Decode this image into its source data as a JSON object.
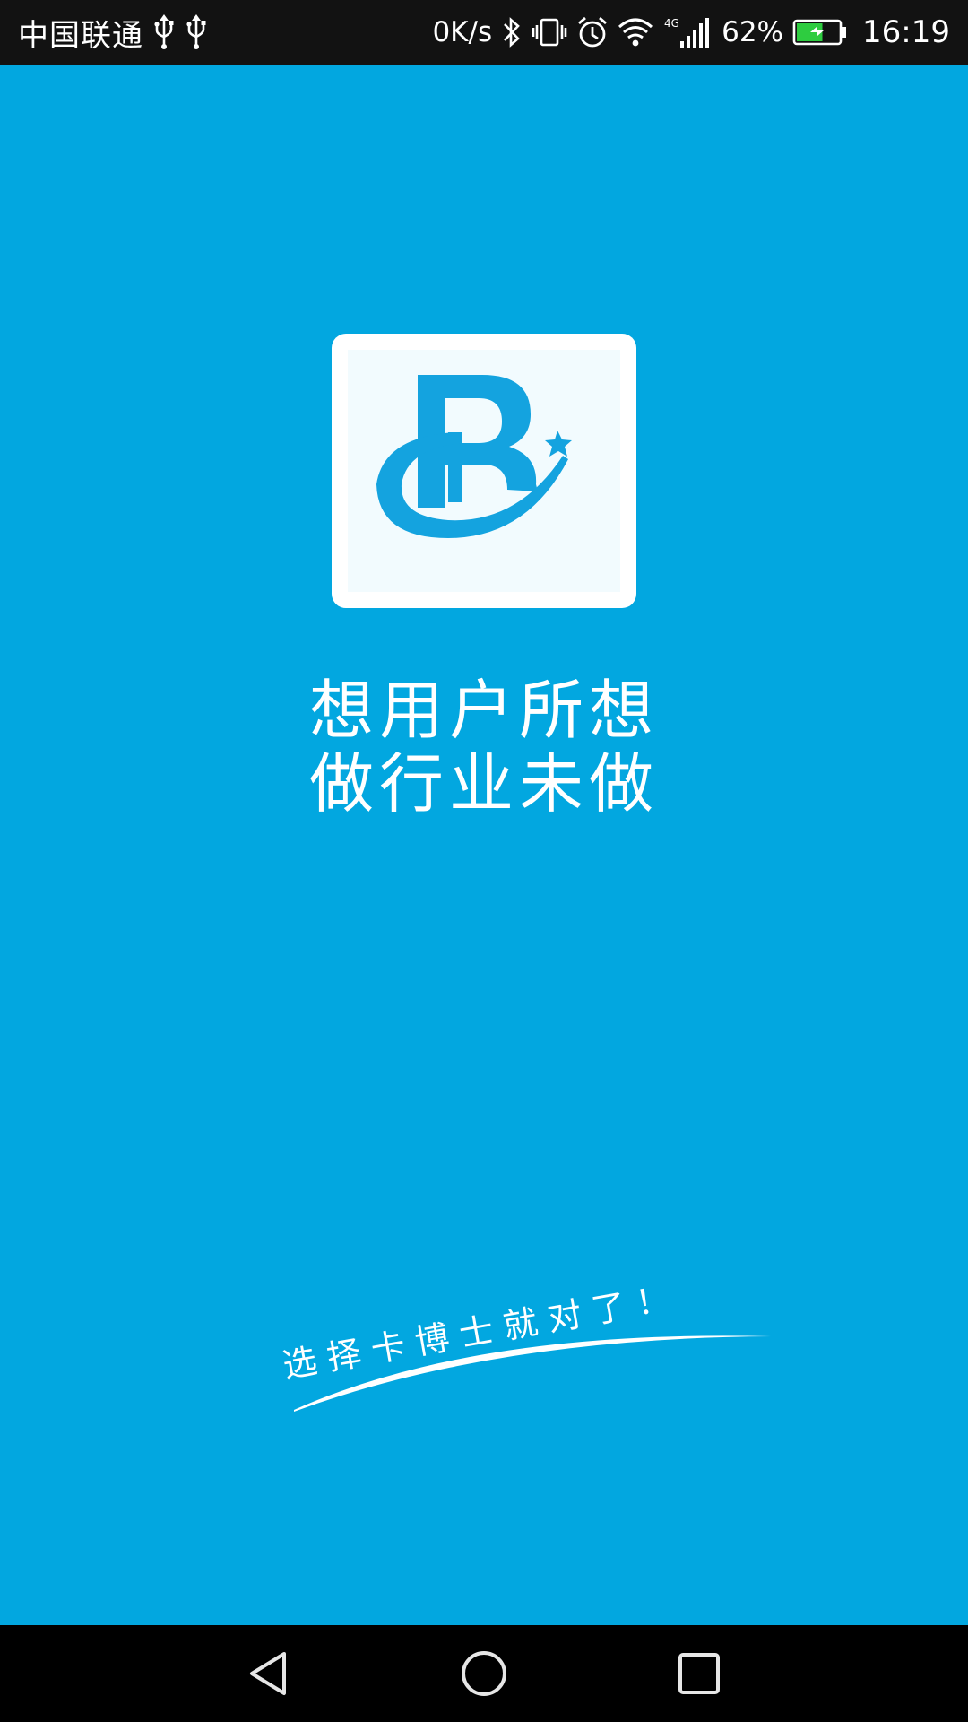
{
  "status_bar": {
    "carrier": "中国联通",
    "icons_left": [
      "usb-icon",
      "usb-icon"
    ],
    "net_speed": "0K/s",
    "icons_right": [
      "bluetooth-icon",
      "vibrate-icon",
      "alarm-icon",
      "wifi-icon",
      "signal-4g-icon"
    ],
    "network_type": "4G",
    "battery_percent": "62%",
    "battery_level": 0.62,
    "battery_charging": true,
    "time": "16:19"
  },
  "splash": {
    "logo_icon": "brand-b-star-logo-icon",
    "slogan_line1": "想用户所想",
    "slogan_line2": "做行业未做",
    "tagline": "选择卡博士就对了！"
  },
  "nav_bar": {
    "icons": [
      "back-icon",
      "home-icon",
      "recent-apps-icon"
    ]
  },
  "colors": {
    "background": "#02a7e0",
    "status_bar": "#121212",
    "nav_bar": "#000000",
    "logo_blue": "#14a3df",
    "text": "#ffffff",
    "battery_fill": "#2ecc40"
  }
}
